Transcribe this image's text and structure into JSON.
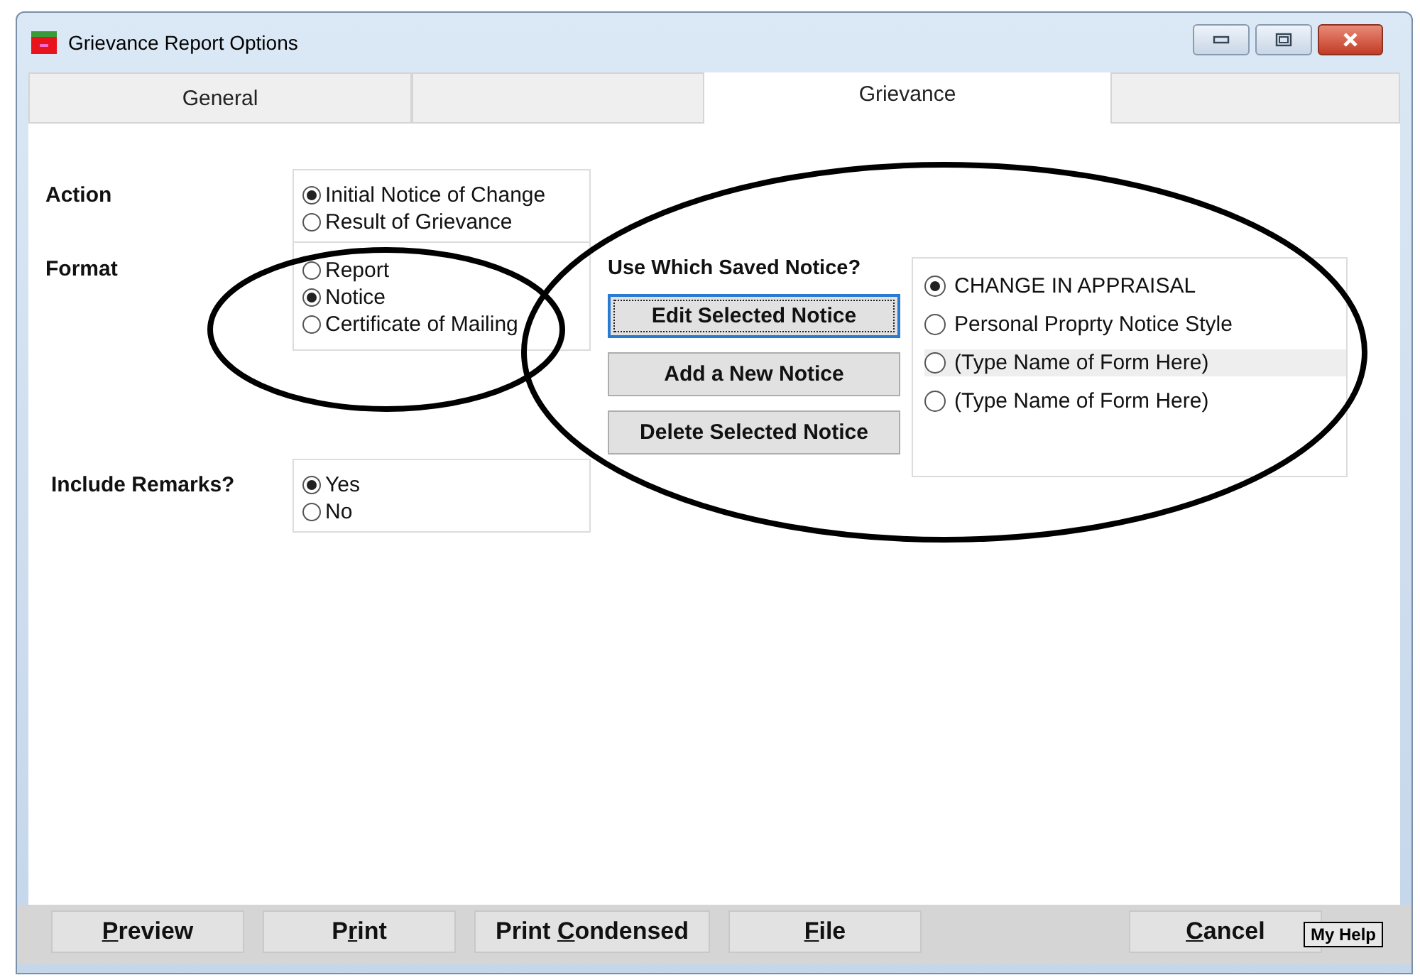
{
  "window": {
    "title": "Grievance Report Options"
  },
  "tabs": [
    {
      "label": "General",
      "selected": false
    },
    {
      "selected": false
    },
    {
      "label": "Grievance",
      "selected": true
    },
    {
      "selected": false
    }
  ],
  "action": {
    "label": "Action",
    "options": [
      {
        "label": "Initial Notice of Change",
        "selected": true
      },
      {
        "label": "Result of Grievance",
        "selected": false
      }
    ]
  },
  "format": {
    "label": "Format",
    "options": [
      {
        "label": "Report",
        "selected": false
      },
      {
        "label": "Notice",
        "selected": true
      },
      {
        "label": "Certificate of Mailing",
        "selected": false
      }
    ]
  },
  "include_remarks": {
    "label": "Include Remarks?",
    "options": [
      {
        "label": "Yes",
        "selected": true
      },
      {
        "label": "No",
        "selected": false
      }
    ]
  },
  "saved_notice": {
    "label": "Use Which Saved Notice?",
    "buttons": [
      {
        "label": "Edit Selected Notice",
        "focused": true
      },
      {
        "label": "Add a New Notice",
        "focused": false
      },
      {
        "label": "Delete Selected Notice",
        "focused": false
      }
    ],
    "options": [
      {
        "label": "CHANGE IN APPRAISAL",
        "selected": true,
        "highlighted": false
      },
      {
        "label": "Personal Proprty Notice Style",
        "selected": false,
        "highlighted": false
      },
      {
        "label": "(Type Name of Form Here)",
        "selected": false,
        "highlighted": true
      },
      {
        "label": "(Type Name of Form Here)",
        "selected": false,
        "highlighted": false
      }
    ]
  },
  "bottom_buttons": [
    {
      "key": "P",
      "after": "review"
    },
    {
      "before": "P",
      "key": "r",
      "after": "int"
    },
    {
      "before": "Print ",
      "key": "C",
      "after": "ondensed"
    },
    {
      "key": "F",
      "after": "ile"
    },
    {
      "key": "C",
      "after": "ancel",
      "kind": "right"
    }
  ],
  "help": {
    "label": "My Help"
  }
}
